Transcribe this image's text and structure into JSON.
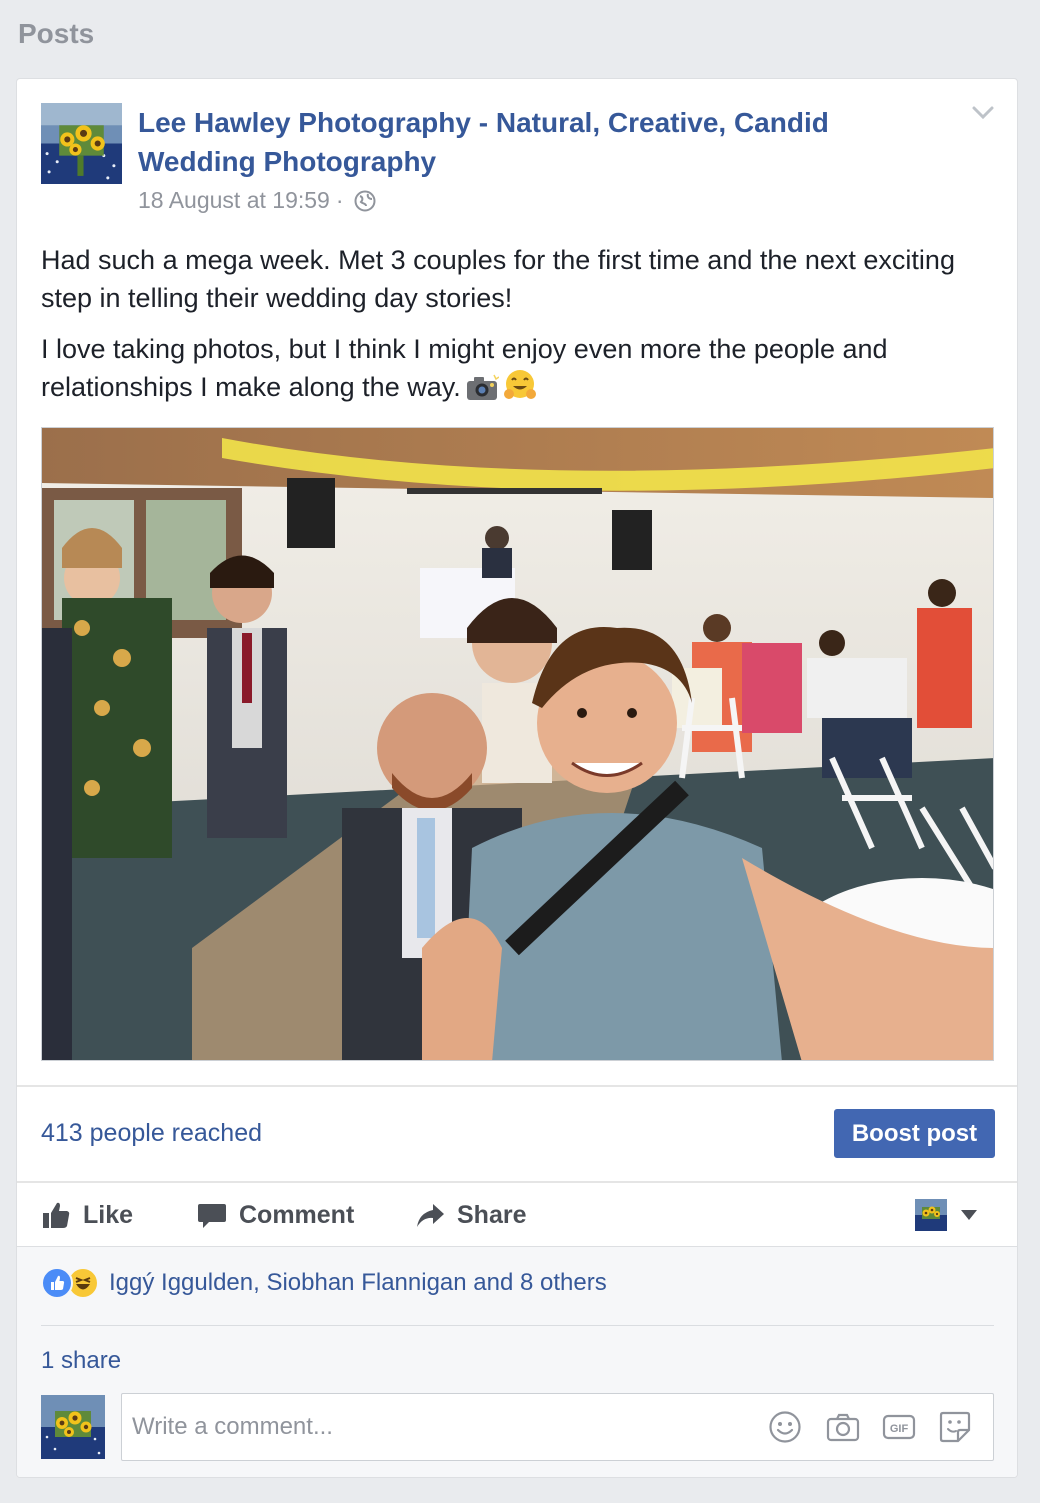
{
  "section": {
    "title": "Posts"
  },
  "post": {
    "page_name": "Lee Hawley Photography - Natural, Creative, Candid Wedding Photography",
    "timestamp": "18 August at 19:59",
    "separator": "·",
    "audience_icon": "globe-icon",
    "paragraphs": [
      "Had such a mega week. Met 3 couples for the first time and the next exciting step in telling their wedding day stories!",
      "I love taking photos, but I think I might enjoy even more the people and relationships I make along the way."
    ],
    "emojis": [
      "camera-flash-emoji",
      "hugging-face-emoji"
    ]
  },
  "insights": {
    "reach_text": "413 people reached",
    "boost_label": "Boost post"
  },
  "actions": {
    "like_label": "Like",
    "comment_label": "Comment",
    "share_label": "Share"
  },
  "reactions": {
    "icons": [
      "like-reaction-icon",
      "haha-reaction-icon"
    ],
    "text": "Iggý Iggulden, Siobhan Flannigan and 8 others",
    "shares_text": "1 share"
  },
  "comment": {
    "placeholder": "Write a comment..."
  },
  "colors": {
    "link": "#365899",
    "boost": "#4267b2",
    "background": "#e9ebee",
    "muted": "#90949c"
  }
}
